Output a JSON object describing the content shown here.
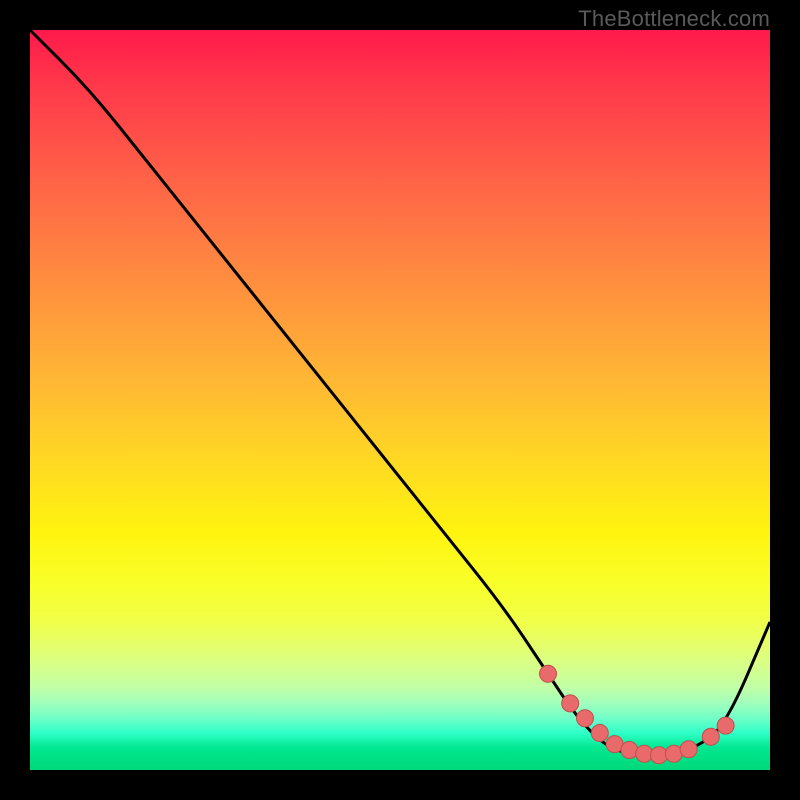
{
  "watermark": "TheBottleneck.com",
  "colors": {
    "background": "#000000",
    "curve_stroke": "#000000",
    "marker_fill": "#e86a6a",
    "marker_stroke": "#c24e4e"
  },
  "chart_data": {
    "type": "line",
    "title": "",
    "xlabel": "",
    "ylabel": "",
    "xlim": [
      0,
      100
    ],
    "ylim": [
      0,
      100
    ],
    "grid": false,
    "legend": false,
    "series": [
      {
        "name": "bottleneck-curve",
        "x": [
          0,
          8,
          16,
          24,
          32,
          40,
          48,
          56,
          64,
          70,
          74,
          78,
          82,
          86,
          90,
          94,
          100
        ],
        "y": [
          100,
          92,
          82,
          72,
          62,
          52,
          42,
          32,
          22,
          13,
          7,
          3,
          2,
          2,
          3,
          6,
          20
        ]
      }
    ],
    "markers": {
      "name": "highlighted-points",
      "x": [
        70,
        73,
        75,
        77,
        79,
        81,
        83,
        85,
        87,
        89,
        92,
        94
      ],
      "y": [
        13,
        9,
        7,
        5,
        3.5,
        2.7,
        2.2,
        2,
        2.2,
        2.8,
        4.5,
        6
      ]
    }
  }
}
